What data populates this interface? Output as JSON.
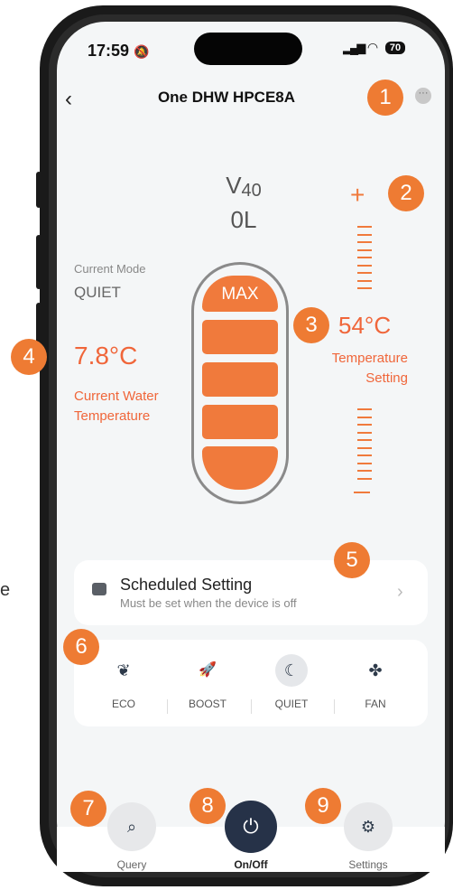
{
  "status_bar": {
    "time": "17:59",
    "bell_icon": "bell-slash-icon",
    "signal": "signal-icon",
    "wifi": "wifi-icon",
    "battery": "70"
  },
  "header": {
    "back_icon": "back-chevron-icon",
    "title": "One DHW HPCE8A",
    "more_icon": "more-icon"
  },
  "badges": [
    "1",
    "2",
    "3",
    "4",
    "5",
    "6",
    "7",
    "8",
    "9"
  ],
  "tank": {
    "model": "V",
    "model_sub": "40",
    "volume": "0L",
    "max_label": "MAX"
  },
  "current_mode": {
    "label": "Current Mode",
    "value": "QUIET"
  },
  "current_water": {
    "value": "7.8°C",
    "label_line1": "Current Water",
    "label_line2": "Temperature"
  },
  "temperature_setting": {
    "plus": "+",
    "value": "54°C",
    "label_line1": "Temperature",
    "label_line2": "Setting"
  },
  "scheduled": {
    "title": "Scheduled Setting",
    "subtitle": "Must be set when the device is off",
    "chevron": "›"
  },
  "modes": [
    {
      "label": "ECO",
      "icon": "leaf-icon",
      "glyph": "❦",
      "active": false
    },
    {
      "label": "BOOST",
      "icon": "rocket-icon",
      "glyph": "🚀",
      "active": false
    },
    {
      "label": "QUIET",
      "icon": "moon-icon",
      "glyph": "☾",
      "active": true
    },
    {
      "label": "FAN",
      "icon": "fan-icon",
      "glyph": "✤",
      "active": false
    }
  ],
  "bottom_nav": {
    "query": {
      "label": "Query",
      "icon": "magnifier-icon",
      "glyph": "⌕"
    },
    "power": {
      "label": "On/Off",
      "icon": "power-icon",
      "glyph": "⏻"
    },
    "settings": {
      "label": "Settings",
      "icon": "gear-icon",
      "glyph": "⚙"
    }
  },
  "edge_text": "e",
  "colors": {
    "accent": "#f07a3c",
    "badge": "#ee7b33",
    "power_bg": "#263248"
  }
}
